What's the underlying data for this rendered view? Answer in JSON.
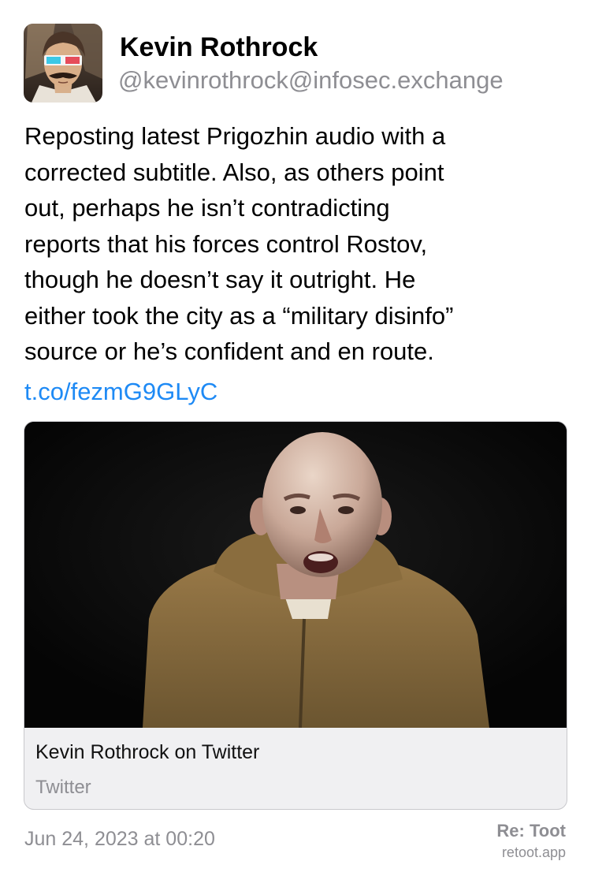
{
  "author": {
    "display_name": "Kevin Rothrock",
    "handle": "@kevinrothrock@infosec.exchange"
  },
  "post": {
    "text_lines": [
      "Reposting latest Prigozhin audio with a",
      "corrected subtitle. Also, as others point",
      "out, perhaps he isn’t contradicting",
      "reports that his forces control Rostov,",
      "though he doesn’t say it outright. He",
      "either took the city as a “military disinfo”",
      "source or he’s confident and en route."
    ],
    "link": "t.co/fezmG9GLyC",
    "timestamp": "Jun 24, 2023 at 00:20"
  },
  "card": {
    "title": "Kevin Rothrock on Twitter",
    "source": "Twitter"
  },
  "branding": {
    "title": "Re: Toot",
    "subtitle": "retoot.app"
  },
  "colors": {
    "link": "#1e8af5",
    "secondary_text": "#8e8e93",
    "card_background": "#f0f0f2",
    "card_border": "#c8c8cc"
  }
}
